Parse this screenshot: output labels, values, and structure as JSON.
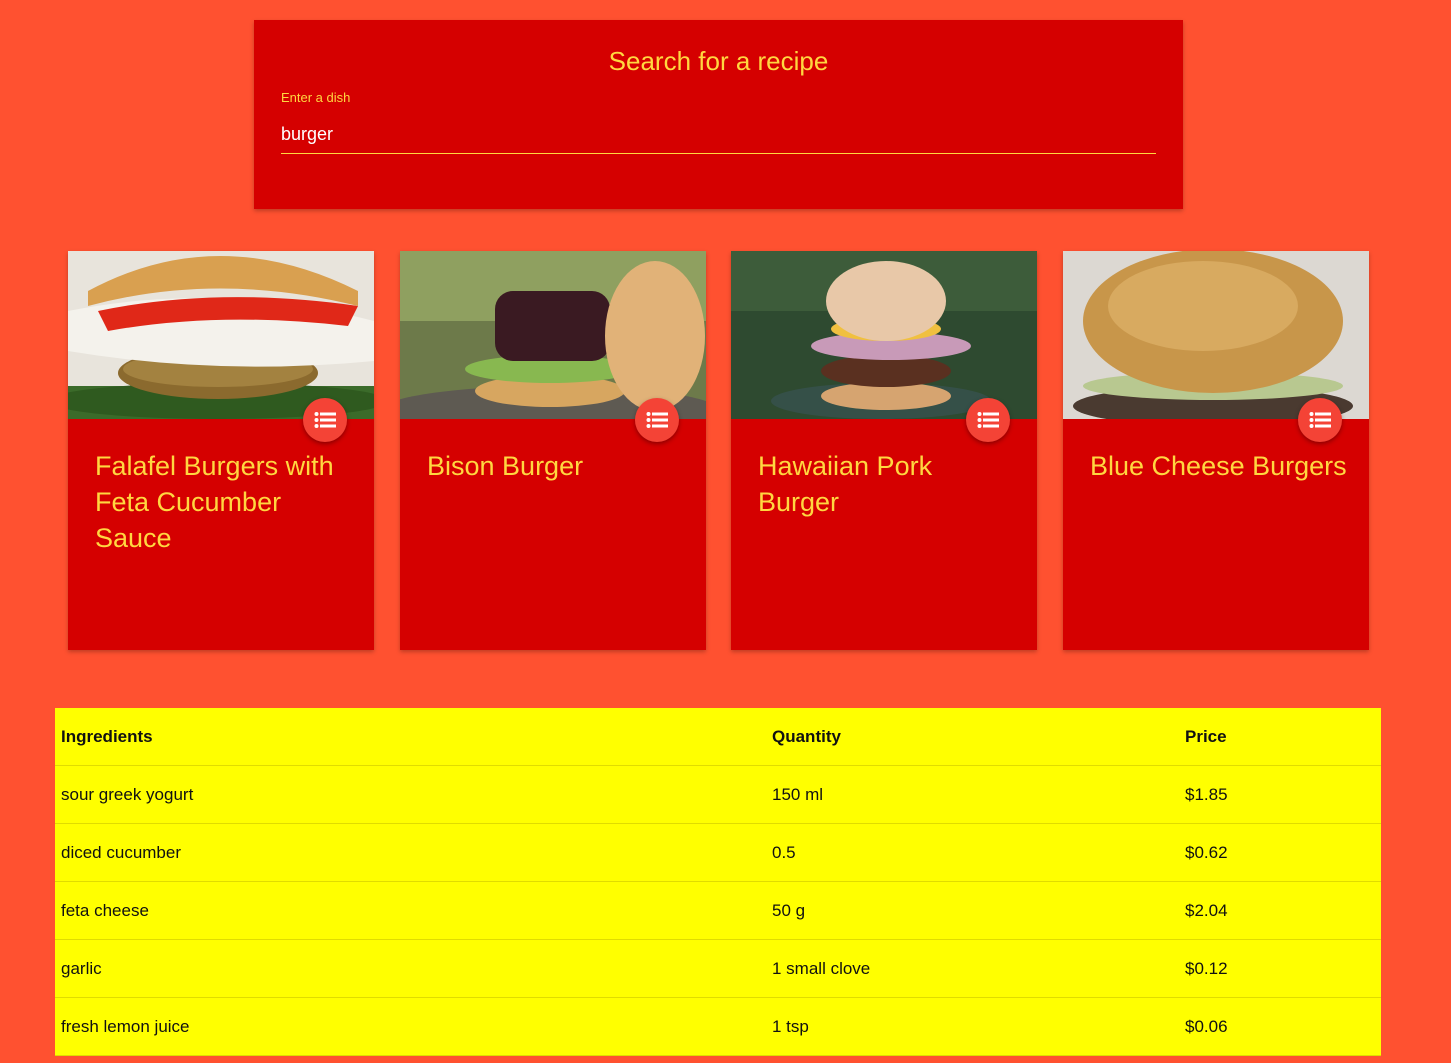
{
  "search": {
    "title": "Search for a recipe",
    "label": "Enter a dish",
    "value": "burger"
  },
  "recipes": [
    {
      "title": "Falafel Burgers with Feta Cucumber Sauce",
      "icon": "list-icon"
    },
    {
      "title": "Bison Burger",
      "icon": "list-icon"
    },
    {
      "title": "Hawaiian Pork Burger",
      "icon": "list-icon"
    },
    {
      "title": "Blue Cheese Burgers",
      "icon": "list-icon"
    }
  ],
  "table": {
    "headers": {
      "ingredient": "Ingredients",
      "quantity": "Quantity",
      "price": "Price"
    },
    "rows": [
      {
        "ingredient": "sour greek yogurt",
        "quantity": "150 ml",
        "price": "$1.85"
      },
      {
        "ingredient": "diced cucumber",
        "quantity": "0.5",
        "price": "$0.62"
      },
      {
        "ingredient": "feta cheese",
        "quantity": "50 g",
        "price": "$2.04"
      },
      {
        "ingredient": "garlic",
        "quantity": "1 small clove",
        "price": "$0.12"
      },
      {
        "ingredient": "fresh lemon juice",
        "quantity": "1 tsp",
        "price": "$0.06"
      }
    ]
  },
  "colors": {
    "background": "#ff5130",
    "card": "#d50000",
    "accent_text": "#ffd740",
    "fab": "#f44336",
    "table_bg": "#ffff00"
  }
}
